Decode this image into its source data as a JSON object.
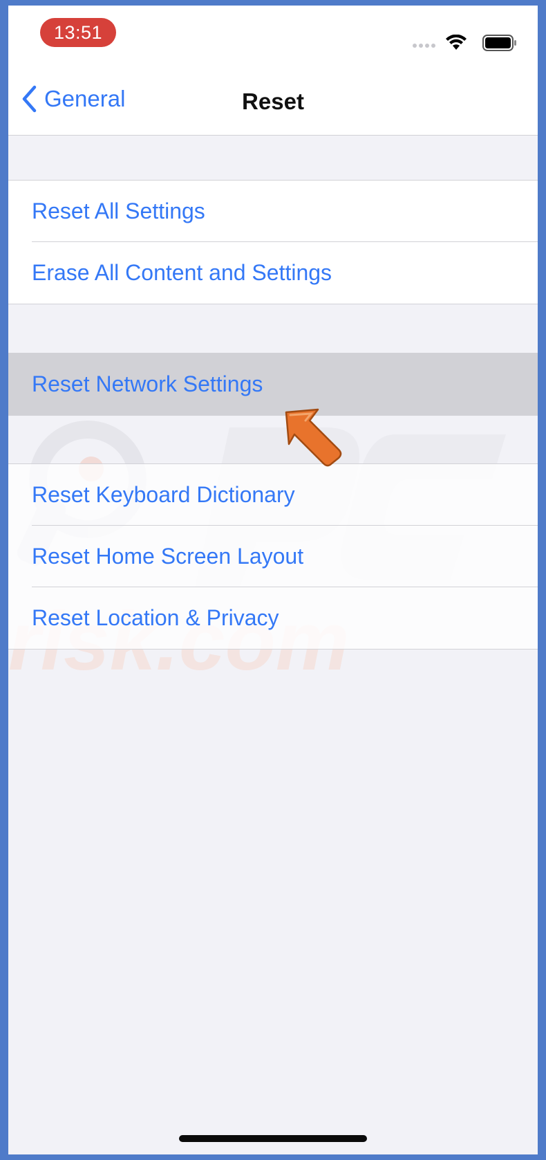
{
  "status_bar": {
    "time": "13:51",
    "icons": [
      "signal-icon",
      "wifi-icon",
      "battery-icon"
    ]
  },
  "nav": {
    "back_label": "General",
    "title": "Reset"
  },
  "groups": [
    {
      "items": [
        "Reset All Settings",
        "Erase All Content and Settings"
      ]
    },
    {
      "items": [
        "Reset Network Settings"
      ],
      "highlighted": "Reset Network Settings"
    },
    {
      "items": [
        "Reset Keyboard Dictionary",
        "Reset Home Screen Layout",
        "Reset Location & Privacy"
      ]
    }
  ],
  "watermark": {
    "text": "risk.com",
    "logo": "pcrisk-logo"
  },
  "colors": {
    "accent": "#3478f6",
    "background": "#f2f2f7",
    "highlight": "#d1d1d6",
    "time_pill": "#d6413a",
    "arrow": "#e8732c",
    "frame": "#4f7bc9"
  }
}
